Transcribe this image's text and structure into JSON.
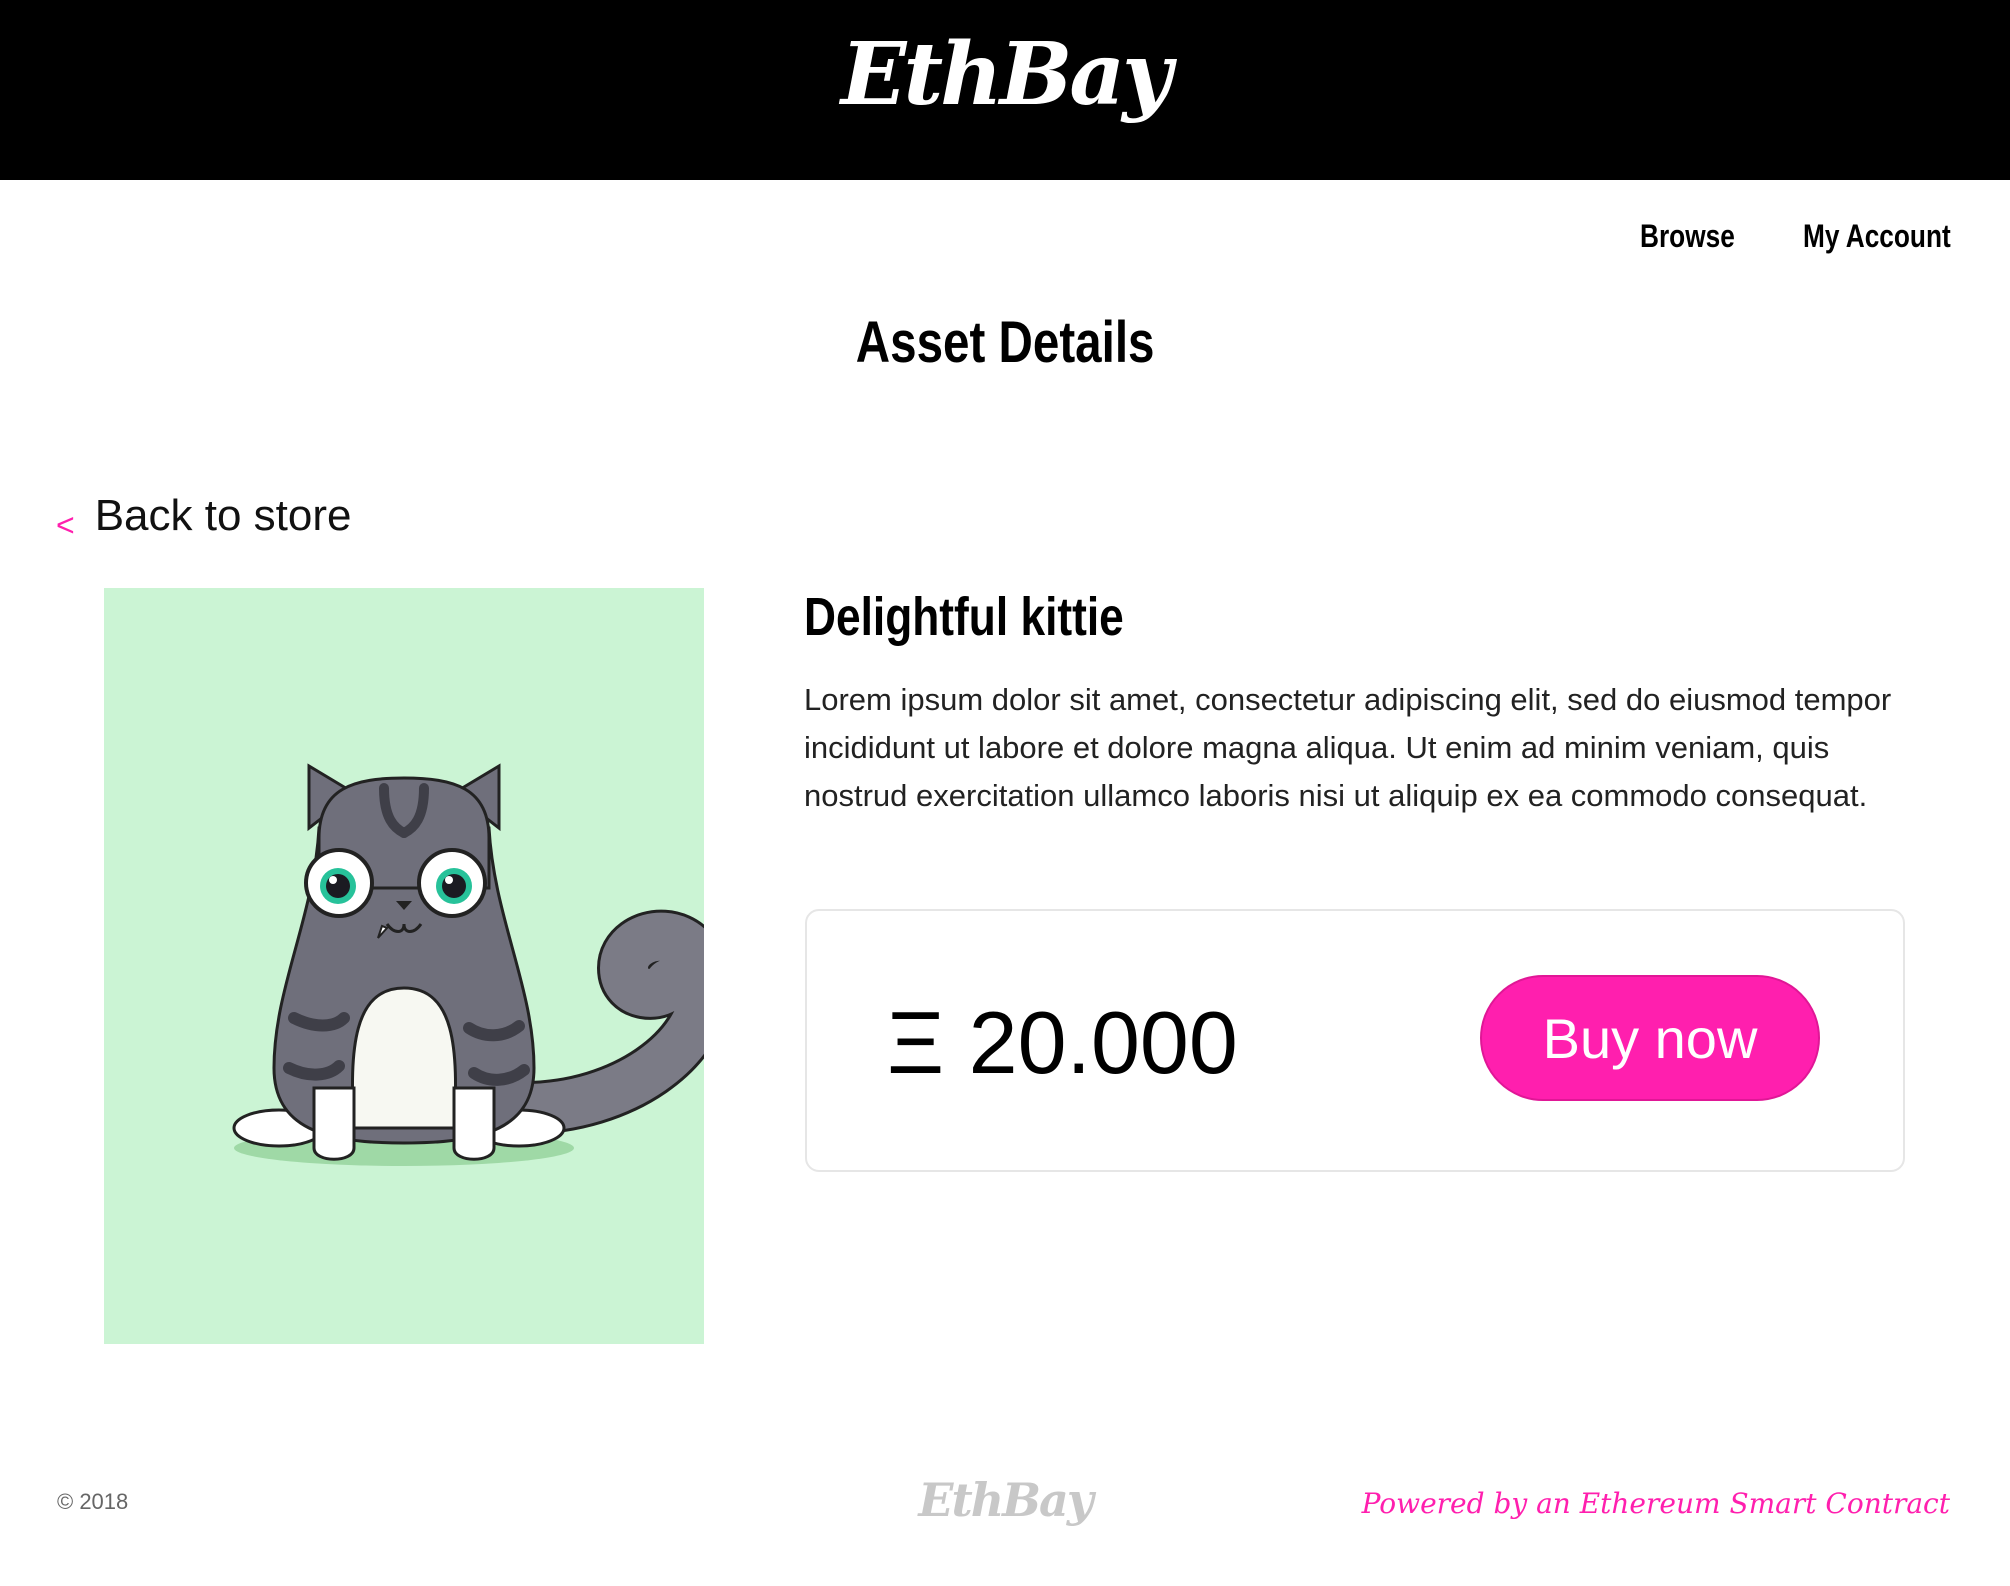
{
  "header": {
    "brand": "EthBay"
  },
  "nav": {
    "browse": "Browse",
    "account": "My Account"
  },
  "page": {
    "title": "Asset Details"
  },
  "back": {
    "chevron": "<",
    "label": "Back to store"
  },
  "asset": {
    "name": "Delightful kittie",
    "description": "Lorem ipsum dolor sit amet, consectetur adipiscing elit, sed do eiusmod tempor incididunt ut labore et dolore magna aliqua. Ut enim ad minim veniam, quis nostrud exercitation ullamco laboris nisi ut aliquip ex ea commodo consequat.",
    "price": "Ξ 20.000",
    "buy_label": "Buy now",
    "image_background": "#cbf4d4"
  },
  "footer": {
    "copyright": "© 2018",
    "brand": "EthBay",
    "powered_by": "Powered by an Ethereum Smart Contract"
  },
  "colors": {
    "accent": "#ff1fae",
    "header_bg": "#000000"
  }
}
